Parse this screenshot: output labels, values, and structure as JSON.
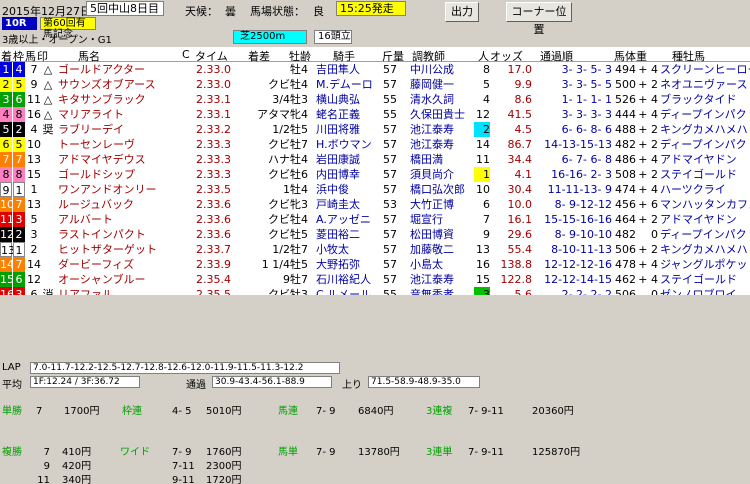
{
  "header": {
    "date": "2015年12月27日",
    "meeting": "5回中山8日目",
    "weather_label": "天候：",
    "weather": "曇",
    "track_label": "馬場状態：",
    "track": "良",
    "start_time": "15:25発走",
    "btn_output": "出力",
    "btn_corner": "コーナー位置",
    "race_no": "10R",
    "race_name": "第60回有馬記念",
    "conditions": "3歳以上・オープン・G1",
    "distance": "芝2500m",
    "runners": "16頭立"
  },
  "columns": [
    "着",
    "枠",
    "馬",
    "印",
    "馬名",
    "C",
    "タイム",
    "着差",
    "牡齢",
    "騎手",
    "斤量",
    "調教師",
    "人",
    "オッズ",
    "通過順",
    "馬体重",
    "種牡馬"
  ],
  "rows": [
    {
      "pos": "1",
      "waku": "4",
      "uma": "7",
      "mark": "△",
      "name": "ゴールドアクター",
      "time": "2.33.0",
      "margin": "",
      "sex": "牡4",
      "jockey": "吉田隼人",
      "wt": "57",
      "trainer": "中川公成",
      "pop": "8",
      "odds": "17.0",
      "pass": "3- 3- 5- 3",
      "bw": "494",
      "diff": "+ 4",
      "sire": "スクリーンヒーロー"
    },
    {
      "pos": "2",
      "waku": "5",
      "uma": "9",
      "mark": "△",
      "name": "サウンズオブアース",
      "time": "2.33.0",
      "margin": "クビ",
      "sex": "牡4",
      "jockey": "M.デムーロ",
      "wt": "57",
      "trainer": "藤岡健一",
      "pop": "5",
      "odds": "9.9",
      "pass": "3- 3- 5- 5",
      "bw": "500",
      "diff": "+ 2",
      "sire": "ネオユニヴァース"
    },
    {
      "pos": "3",
      "waku": "6",
      "uma": "11",
      "mark": "△",
      "name": "キタサンブラック",
      "time": "2.33.1",
      "margin": "3/4",
      "sex": "牡3",
      "jockey": "横山典弘",
      "wt": "55",
      "trainer": "清水久詞",
      "pop": "4",
      "odds": "8.6",
      "pass": "1- 1- 1- 1",
      "bw": "526",
      "diff": "+ 4",
      "sire": "ブラックタイド"
    },
    {
      "pos": "4",
      "waku": "8",
      "uma": "16",
      "mark": "△",
      "name": "マリアライト",
      "time": "2.33.1",
      "margin": "アタマ",
      "sex": "牝4",
      "jockey": "蛯名正義",
      "wt": "55",
      "trainer": "久保田貴士",
      "pop": "12",
      "odds": "41.5",
      "pass": "3- 3- 3- 3",
      "bw": "444",
      "diff": "+ 4",
      "sire": "ディープインパクト"
    },
    {
      "pos": "5",
      "waku": "2",
      "uma": "4",
      "mark": "奨",
      "name": "ラブリーデイ",
      "time": "2.33.2",
      "margin": "1/2",
      "sex": "牡5",
      "jockey": "川田将雅",
      "wt": "57",
      "trainer": "池江泰寿",
      "pop": "2",
      "odds": "4.5",
      "pass": "6- 6- 8- 6",
      "bw": "488",
      "diff": "+ 2",
      "sire": "キングカメハメハ",
      "hl": "blue"
    },
    {
      "pos": "6",
      "waku": "5",
      "uma": "10",
      "mark": "",
      "name": "トーセンレーヴ",
      "time": "2.33.3",
      "margin": "クビ",
      "sex": "牡7",
      "jockey": "H.ボウマン",
      "wt": "57",
      "trainer": "池江泰寿",
      "pop": "14",
      "odds": "86.7",
      "pass": "14-13-15-13",
      "bw": "482",
      "diff": "+ 2",
      "sire": "ディープインパクト"
    },
    {
      "pos": "7",
      "waku": "7",
      "uma": "13",
      "mark": "",
      "name": "アドマイヤデウス",
      "time": "2.33.3",
      "margin": "ハナ",
      "sex": "牡4",
      "jockey": "岩田康誠",
      "wt": "57",
      "trainer": "橋田満",
      "pop": "11",
      "odds": "34.4",
      "pass": "6- 7- 6- 8",
      "bw": "486",
      "diff": "+ 4",
      "sire": "アドマイヤドン"
    },
    {
      "pos": "8",
      "waku": "8",
      "uma": "15",
      "mark": "",
      "name": "ゴールドシップ",
      "time": "2.33.3",
      "margin": "クビ",
      "sex": "牡6",
      "jockey": "内田博幸",
      "wt": "57",
      "trainer": "須貝尚介",
      "pop": "1",
      "odds": "4.1",
      "pass": "16-16- 2- 3",
      "bw": "508",
      "diff": "+ 2",
      "sire": "ステイゴールド",
      "hl": "yellow"
    },
    {
      "pos": "9",
      "waku": "1",
      "uma": "1",
      "mark": "",
      "name": "ワンアンドオンリー",
      "time": "2.33.5",
      "margin": "1",
      "sex": "牡4",
      "jockey": "浜中俊",
      "wt": "57",
      "trainer": "橋口弘次郎",
      "pop": "10",
      "odds": "30.4",
      "pass": "11-11-13- 9",
      "bw": "474",
      "diff": "+ 4",
      "sire": "ハーツクライ"
    },
    {
      "pos": "10",
      "waku": "7",
      "uma": "13",
      "mark": "",
      "name": "ルージュバック",
      "time": "2.33.6",
      "margin": "クビ",
      "sex": "牝3",
      "jockey": "戸崎圭太",
      "wt": "53",
      "trainer": "大竹正博",
      "pop": "6",
      "odds": "10.0",
      "pass": "8- 9-12-12",
      "bw": "456",
      "diff": "+ 6",
      "sire": "マンハッタンカフェ"
    },
    {
      "pos": "11",
      "waku": "3",
      "uma": "5",
      "mark": "",
      "name": "アルバート",
      "time": "2.33.6",
      "margin": "クビ",
      "sex": "牡4",
      "jockey": "A.アッゼニ",
      "wt": "57",
      "trainer": "堀宣行",
      "pop": "7",
      "odds": "16.1",
      "pass": "15-15-16-16",
      "bw": "464",
      "diff": "+ 2",
      "sire": "アドマイヤドン"
    },
    {
      "pos": "12",
      "waku": "2",
      "uma": "3",
      "mark": "",
      "name": "ラストインパクト",
      "time": "2.33.6",
      "margin": "クビ",
      "sex": "牡5",
      "jockey": "菱田裕二",
      "wt": "57",
      "trainer": "松田博資",
      "pop": "9",
      "odds": "29.6",
      "pass": "8- 9-10-10",
      "bw": "482",
      "diff": "0",
      "sire": "ディープインパクト"
    },
    {
      "pos": "13",
      "waku": "1",
      "uma": "2",
      "mark": "",
      "name": "ヒットザターゲット",
      "time": "2.33.7",
      "margin": "1/2",
      "sex": "牡7",
      "jockey": "小牧太",
      "wt": "57",
      "trainer": "加藤敬二",
      "pop": "13",
      "odds": "55.4",
      "pass": "8-10-11-13",
      "bw": "506",
      "diff": "+ 2",
      "sire": "キングカメハメハ"
    },
    {
      "pos": "14",
      "waku": "7",
      "uma": "14",
      "mark": "",
      "name": "ダービーフィズ",
      "time": "2.33.9",
      "margin": "1 1/4",
      "sex": "牡5",
      "jockey": "大野拓弥",
      "wt": "57",
      "trainer": "小島太",
      "pop": "16",
      "odds": "138.8",
      "pass": "12-12-12-16",
      "bw": "478",
      "diff": "+ 4",
      "sire": "ジャングルポケット"
    },
    {
      "pos": "15",
      "waku": "6",
      "uma": "12",
      "mark": "",
      "name": "オーシャンブルー",
      "time": "2.35.4",
      "margin": "9",
      "sex": "牡7",
      "jockey": "石川裕紀人",
      "wt": "57",
      "trainer": "池江泰寿",
      "pop": "15",
      "odds": "122.8",
      "pass": "12-12-14-15",
      "bw": "462",
      "diff": "+ 4",
      "sire": "ステイゴールド"
    },
    {
      "pos": "16",
      "waku": "3",
      "uma": "6",
      "mark": "消",
      "name": "リアファル",
      "time": "2.35.5",
      "margin": "クビ",
      "sex": "牡3",
      "jockey": "C.ルメール",
      "wt": "55",
      "trainer": "音無秀孝",
      "pop": "3",
      "odds": "5.6",
      "pass": "2- 2- 2- 2",
      "bw": "506",
      "diff": "0",
      "sire": "ゼンノロブロイ",
      "hl": "green"
    }
  ],
  "lap": {
    "lap_label": "LAP",
    "lap": "7.0-11.7-12.2-12.5-12.7-12.8-12.6-12.0-11.9-11.5-11.3-12.2",
    "avg_label": "平均",
    "avg": "1F:12.24 / 3F:36.72",
    "pass_label": "通過",
    "pass": "30.9-43.4-56.1-88.9",
    "up_label": "上り",
    "up": "71.5-58.9-48.9-35.0"
  },
  "payouts": {
    "tansho_label": "単勝",
    "tansho": "7",
    "tansho_pay": "1700円",
    "wakuren_label": "枠連",
    "wakuren": "4- 5",
    "wakuren_pay": "5010円",
    "umaren_label": "馬連",
    "umaren": "7- 9",
    "umaren_pay": "6840円",
    "sanrenpuku_label": "3連複",
    "sanrenpuku": "7- 9-11",
    "sanrenpuku_pay": "20360円",
    "fukusho_label": "複勝",
    "fukusho": [
      "7",
      "9",
      "11"
    ],
    "fukusho_pay": [
      "410円",
      "420円",
      "340円"
    ],
    "wide_label": "ワイド",
    "wide": [
      "7- 9",
      "7-11",
      "9-11"
    ],
    "wide_pay": [
      "1760円",
      "2300円",
      "1720円"
    ],
    "umatan_label": "馬単",
    "umatan": "7- 9",
    "umatan_pay": "13780円",
    "sanrentan_label": "3連単",
    "sanrentan": "7- 9-11",
    "sanrentan_pay": "125870円"
  }
}
